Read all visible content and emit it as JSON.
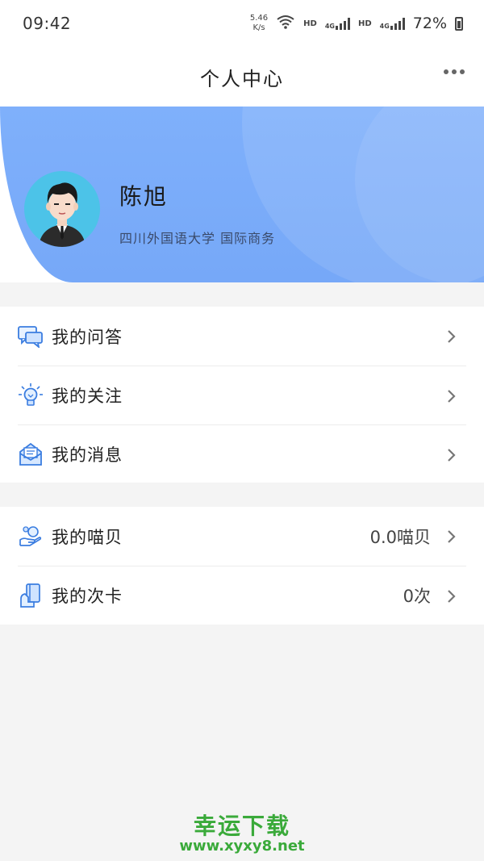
{
  "status_bar": {
    "time": "09:42",
    "net_speed_value": "5.46",
    "net_speed_unit": "K/s",
    "hd1": "HD",
    "hd2": "HD",
    "net1": "4G",
    "net2": "4G",
    "battery": "72%"
  },
  "nav": {
    "title": "个人中心",
    "more_icon": "more-dots-icon"
  },
  "profile": {
    "name": "陈旭",
    "school_major": "四川外国语大学  国际商务",
    "avatar_icon": "avatar-cartoon-man",
    "header_color": "#7fb0fb"
  },
  "menu_group1": [
    {
      "label": "我的问答",
      "icon": "chat-bubbles-icon"
    },
    {
      "label": "我的关注",
      "icon": "lightbulb-icon"
    },
    {
      "label": "我的消息",
      "icon": "envelope-icon"
    }
  ],
  "menu_group2": [
    {
      "label": "我的喵贝",
      "value": "0.0喵贝",
      "icon": "coin-hand-icon"
    },
    {
      "label": "我的次卡",
      "value": "0次",
      "icon": "card-hand-icon"
    }
  ],
  "watermark": {
    "line1": "幸运下载",
    "line2": "www.xyxy8.net",
    "color": "#3aaa3a"
  }
}
